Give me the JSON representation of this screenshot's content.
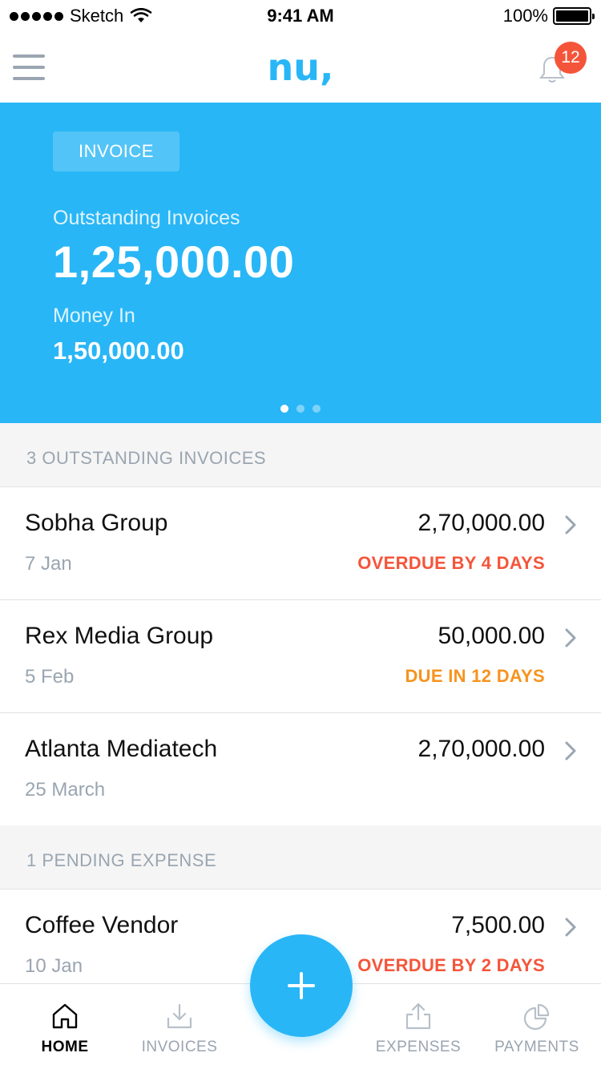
{
  "status_bar": {
    "carrier": "Sketch",
    "time": "9:41 AM",
    "battery": "100%"
  },
  "nav": {
    "brand": "nu,",
    "notification_count": "12",
    "menu_icon": "hamburger-menu-icon",
    "bell_icon": "bell-icon"
  },
  "hero": {
    "tag": "INVOICE",
    "outstanding_label": "Outstanding Invoices",
    "outstanding_amount": "1,25,000.00",
    "money_in_label": "Money In",
    "money_in_amount": "1,50,000.00",
    "page_count": 3,
    "active_page": 1
  },
  "sections": {
    "invoices_header": "3 OUTSTANDING INVOICES",
    "expenses_header": "1 PENDING EXPENSE"
  },
  "invoices": [
    {
      "name": "Sobha Group",
      "date": "7 Jan",
      "amount": "2,70,000.00",
      "status": "OVERDUE BY 4 DAYS",
      "status_type": "overdue"
    },
    {
      "name": "Rex Media Group",
      "date": "5 Feb",
      "amount": "50,000.00",
      "status": "DUE IN 12 DAYS",
      "status_type": "due"
    },
    {
      "name": "Atlanta Mediatech",
      "date": "25 March",
      "amount": "2,70,000.00",
      "status": "",
      "status_type": "none"
    }
  ],
  "expenses": [
    {
      "name": "Coffee Vendor",
      "date": "10 Jan",
      "amount": "7,500.00",
      "status": "OVERDUE BY 2 DAYS",
      "status_type": "overdue"
    }
  ],
  "tabs": [
    {
      "label": "HOME",
      "icon": "home-icon",
      "active": true
    },
    {
      "label": "INVOICES",
      "icon": "download-tray-icon",
      "active": false
    },
    {
      "label": "EXPENSES",
      "icon": "upload-share-icon",
      "active": false
    },
    {
      "label": "PAYMENTS",
      "icon": "pie-chart-icon",
      "active": false
    }
  ],
  "fab": {
    "icon": "plus-icon"
  },
  "colors": {
    "brand": "#29b6f6",
    "overdue": "#f4553a",
    "due": "#f7931e",
    "muted": "#9aa5b1",
    "badge": "#f4553a"
  }
}
